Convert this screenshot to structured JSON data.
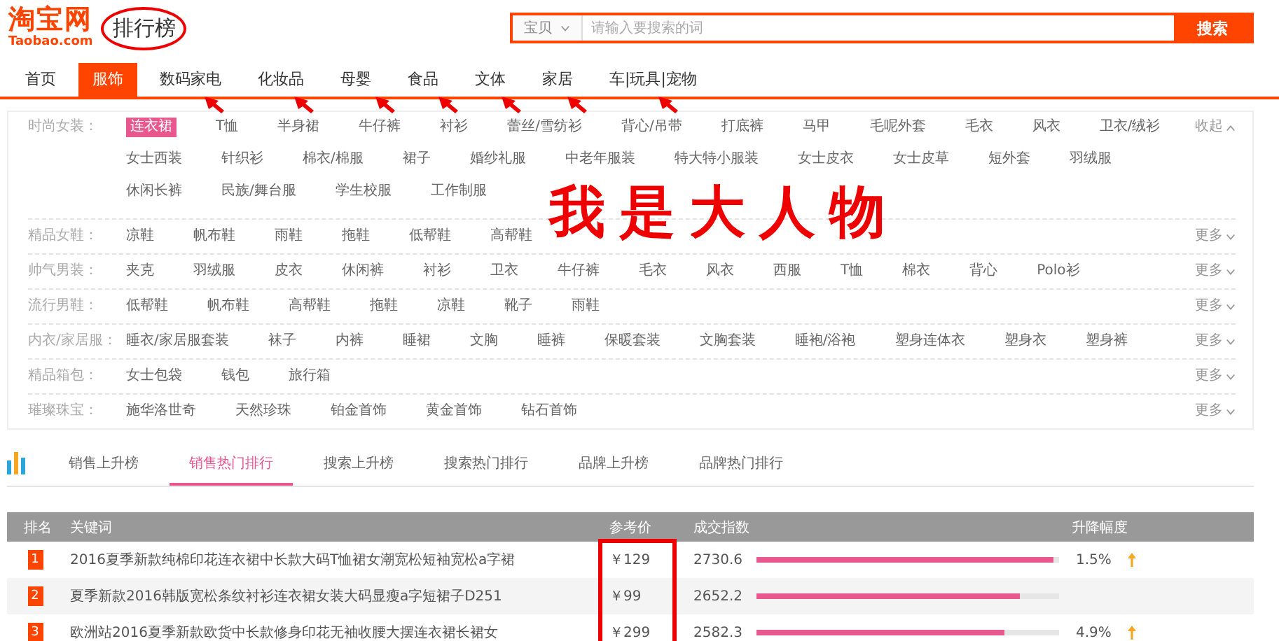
{
  "header": {
    "logo_text": "淘宝网",
    "logo_subtext": "Taobao.com",
    "title": "排行榜",
    "search": {
      "scope": "宝贝",
      "placeholder": "请输入要搜索的词",
      "button": "搜索"
    }
  },
  "nav": [
    {
      "label": "首页",
      "selected": false
    },
    {
      "label": "服饰",
      "selected": true
    },
    {
      "label": "数码家电",
      "selected": false
    },
    {
      "label": "化妆品",
      "selected": false
    },
    {
      "label": "母婴",
      "selected": false
    },
    {
      "label": "食品",
      "selected": false
    },
    {
      "label": "文体",
      "selected": false
    },
    {
      "label": "家居",
      "selected": false
    },
    {
      "label": "车|玩具|宠物",
      "selected": false
    }
  ],
  "categories": [
    {
      "label": "时尚女装：",
      "toggle": "收起",
      "expanded": true,
      "items": [
        {
          "label": "连衣裙",
          "selected": true
        },
        {
          "label": "T恤",
          "selected": false
        },
        {
          "label": "半身裙",
          "selected": false
        },
        {
          "label": "牛仔裤",
          "selected": false
        },
        {
          "label": "衬衫",
          "selected": false
        },
        {
          "label": "蕾丝/雪纺衫",
          "selected": false
        },
        {
          "label": "背心/吊带",
          "selected": false
        },
        {
          "label": "打底裤",
          "selected": false
        },
        {
          "label": "马甲",
          "selected": false
        },
        {
          "label": "毛呢外套",
          "selected": false
        },
        {
          "label": "毛衣",
          "selected": false
        },
        {
          "label": "风衣",
          "selected": false
        },
        {
          "label": "卫衣/绒衫",
          "selected": false
        },
        {
          "label": "女士西装",
          "selected": false
        },
        {
          "label": "针织衫",
          "selected": false
        },
        {
          "label": "棉衣/棉服",
          "selected": false
        },
        {
          "label": "裙子",
          "selected": false
        },
        {
          "label": "婚纱礼服",
          "selected": false
        },
        {
          "label": "中老年服装",
          "selected": false
        },
        {
          "label": "特大特小服装",
          "selected": false
        },
        {
          "label": "女士皮衣",
          "selected": false
        },
        {
          "label": "女士皮草",
          "selected": false
        },
        {
          "label": "短外套",
          "selected": false
        },
        {
          "label": "羽绒服",
          "selected": false
        },
        {
          "label": "休闲长裤",
          "selected": false
        },
        {
          "label": "民族/舞台服",
          "selected": false
        },
        {
          "label": "学生校服",
          "selected": false
        },
        {
          "label": "工作制服",
          "selected": false
        }
      ]
    },
    {
      "label": "精品女鞋：",
      "toggle": "更多",
      "expanded": false,
      "items": [
        {
          "label": "凉鞋",
          "selected": false
        },
        {
          "label": "帆布鞋",
          "selected": false
        },
        {
          "label": "雨鞋",
          "selected": false
        },
        {
          "label": "拖鞋",
          "selected": false
        },
        {
          "label": "低帮鞋",
          "selected": false
        },
        {
          "label": "高帮鞋",
          "selected": false
        }
      ]
    },
    {
      "label": "帅气男装：",
      "toggle": "更多",
      "expanded": false,
      "items": [
        {
          "label": "夹克",
          "selected": false
        },
        {
          "label": "羽绒服",
          "selected": false
        },
        {
          "label": "皮衣",
          "selected": false
        },
        {
          "label": "休闲裤",
          "selected": false
        },
        {
          "label": "衬衫",
          "selected": false
        },
        {
          "label": "卫衣",
          "selected": false
        },
        {
          "label": "牛仔裤",
          "selected": false
        },
        {
          "label": "毛衣",
          "selected": false
        },
        {
          "label": "风衣",
          "selected": false
        },
        {
          "label": "西服",
          "selected": false
        },
        {
          "label": "T恤",
          "selected": false
        },
        {
          "label": "棉衣",
          "selected": false
        },
        {
          "label": "背心",
          "selected": false
        },
        {
          "label": "Polo衫",
          "selected": false
        }
      ]
    },
    {
      "label": "流行男鞋：",
      "toggle": "更多",
      "expanded": false,
      "items": [
        {
          "label": "低帮鞋",
          "selected": false
        },
        {
          "label": "帆布鞋",
          "selected": false
        },
        {
          "label": "高帮鞋",
          "selected": false
        },
        {
          "label": "拖鞋",
          "selected": false
        },
        {
          "label": "凉鞋",
          "selected": false
        },
        {
          "label": "靴子",
          "selected": false
        },
        {
          "label": "雨鞋",
          "selected": false
        }
      ]
    },
    {
      "label": "内衣/家居服：",
      "toggle": "更多",
      "expanded": false,
      "items": [
        {
          "label": "睡衣/家居服套装",
          "selected": false
        },
        {
          "label": "袜子",
          "selected": false
        },
        {
          "label": "内裤",
          "selected": false
        },
        {
          "label": "睡裙",
          "selected": false
        },
        {
          "label": "文胸",
          "selected": false
        },
        {
          "label": "睡裤",
          "selected": false
        },
        {
          "label": "保暖套装",
          "selected": false
        },
        {
          "label": "文胸套装",
          "selected": false
        },
        {
          "label": "睡袍/浴袍",
          "selected": false
        },
        {
          "label": "塑身连体衣",
          "selected": false
        },
        {
          "label": "塑身衣",
          "selected": false
        },
        {
          "label": "塑身裤",
          "selected": false
        }
      ]
    },
    {
      "label": "精品箱包：",
      "toggle": "更多",
      "expanded": false,
      "items": [
        {
          "label": "女士包袋",
          "selected": false
        },
        {
          "label": "钱包",
          "selected": false
        },
        {
          "label": "旅行箱",
          "selected": false
        }
      ]
    },
    {
      "label": "璀璨珠宝：",
      "toggle": "更多",
      "expanded": false,
      "items": [
        {
          "label": "施华洛世奇",
          "selected": false
        },
        {
          "label": "天然珍珠",
          "selected": false
        },
        {
          "label": "铂金首饰",
          "selected": false
        },
        {
          "label": "黄金首饰",
          "selected": false
        },
        {
          "label": "钻石首饰",
          "selected": false
        }
      ]
    }
  ],
  "ranking_tabs": [
    {
      "label": "销售上升榜",
      "selected": false
    },
    {
      "label": "销售热门排行",
      "selected": true
    },
    {
      "label": "搜索上升榜",
      "selected": false
    },
    {
      "label": "搜索热门排行",
      "selected": false
    },
    {
      "label": "品牌上升榜",
      "selected": false
    },
    {
      "label": "品牌热门排行",
      "selected": false
    }
  ],
  "table": {
    "columns": [
      "排名",
      "关键词",
      "参考价",
      "成交指数",
      "升降幅度"
    ],
    "rows": [
      {
        "rank": "1",
        "keyword": "2016夏季新款纯棉印花连衣裙中长款大码T恤裙女潮宽松短袖宽松a字裙",
        "price": "￥129",
        "index": "2730.6",
        "level": 0.98,
        "change": "1.5%"
      },
      {
        "rank": "2",
        "keyword": "夏季新款2016韩版宽松条纹衬衫连衣裙女装大码显瘦a字短裙子D251",
        "price": "￥99",
        "index": "2652.2",
        "level": 0.87
      },
      {
        "rank": "3",
        "keyword": "欧洲站2016夏季新款欧货中长款修身印花无袖收腰大摆连衣裙长裙女",
        "price": "￥299",
        "index": "2582.3",
        "level": 0.82,
        "change": "4.9%"
      }
    ]
  },
  "annotation": {
    "text": "我是大人物"
  }
}
